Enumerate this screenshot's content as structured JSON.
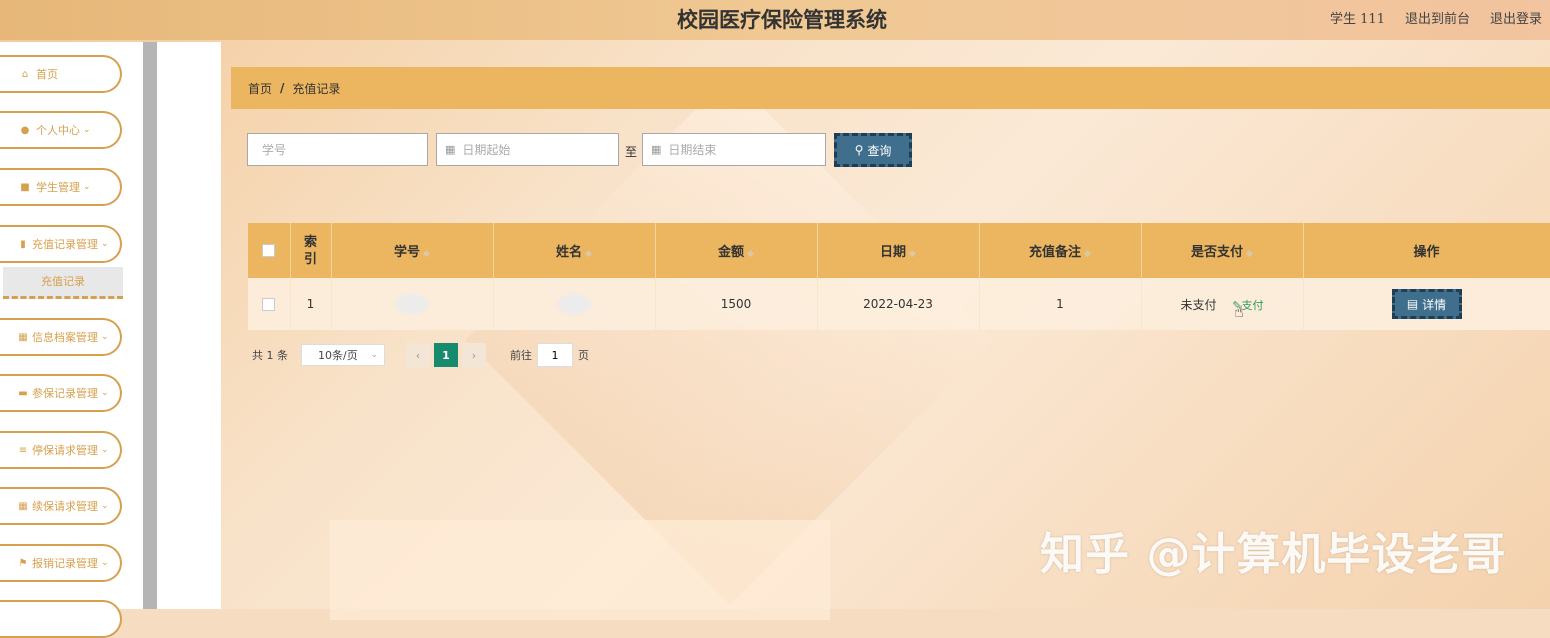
{
  "header": {
    "title": "校园医疗保险管理系统",
    "user": "学生 111",
    "back_to_front": "退出到前台",
    "logout": "退出登录"
  },
  "sidebar": {
    "items": [
      {
        "label": "首页",
        "icon": "home-icon"
      },
      {
        "label": "个人中心",
        "icon": "user-icon"
      },
      {
        "label": "学生管理",
        "icon": "briefcase-icon"
      },
      {
        "label": "充值记录管理",
        "icon": "file-icon"
      },
      {
        "label": "信息档案管理",
        "icon": "grid-icon"
      },
      {
        "label": "参保记录管理",
        "icon": "comment-icon"
      },
      {
        "label": "停保请求管理",
        "icon": "list-icon"
      },
      {
        "label": "续保请求管理",
        "icon": "grid-icon"
      },
      {
        "label": "报销记录管理",
        "icon": "flag-icon"
      }
    ],
    "active_sub": "充值记录"
  },
  "breadcrumb": {
    "home": "首页",
    "sep": "/",
    "current": "充值记录"
  },
  "search": {
    "student_no_placeholder": "学号",
    "date_start_placeholder": "日期起始",
    "to_label": "至",
    "date_end_placeholder": "日期结束",
    "button_label": "查询"
  },
  "table": {
    "headers": {
      "index": "索引",
      "student_no": "学号",
      "name": "姓名",
      "amount": "金额",
      "date": "日期",
      "remark": "充值备注",
      "paid": "是否支付",
      "action": "操作"
    },
    "rows": [
      {
        "index": "1",
        "student_no": "",
        "name": "",
        "amount": "1500",
        "date": "2022-04-23",
        "remark": "1",
        "paid": "未支付",
        "pay_link": "支付",
        "detail": "详情"
      }
    ]
  },
  "pagination": {
    "total": "共 1 条",
    "page_size": "10条/页",
    "current_page": "1",
    "goto_label": "前往",
    "goto_value": "1",
    "page_suffix": "页"
  },
  "watermark": "知乎 @计算机毕设老哥",
  "colors": {
    "accent": "#ebb65f",
    "nav_border": "#d7a04e",
    "button": "#3f6f8c",
    "page_active": "#188a6e"
  }
}
